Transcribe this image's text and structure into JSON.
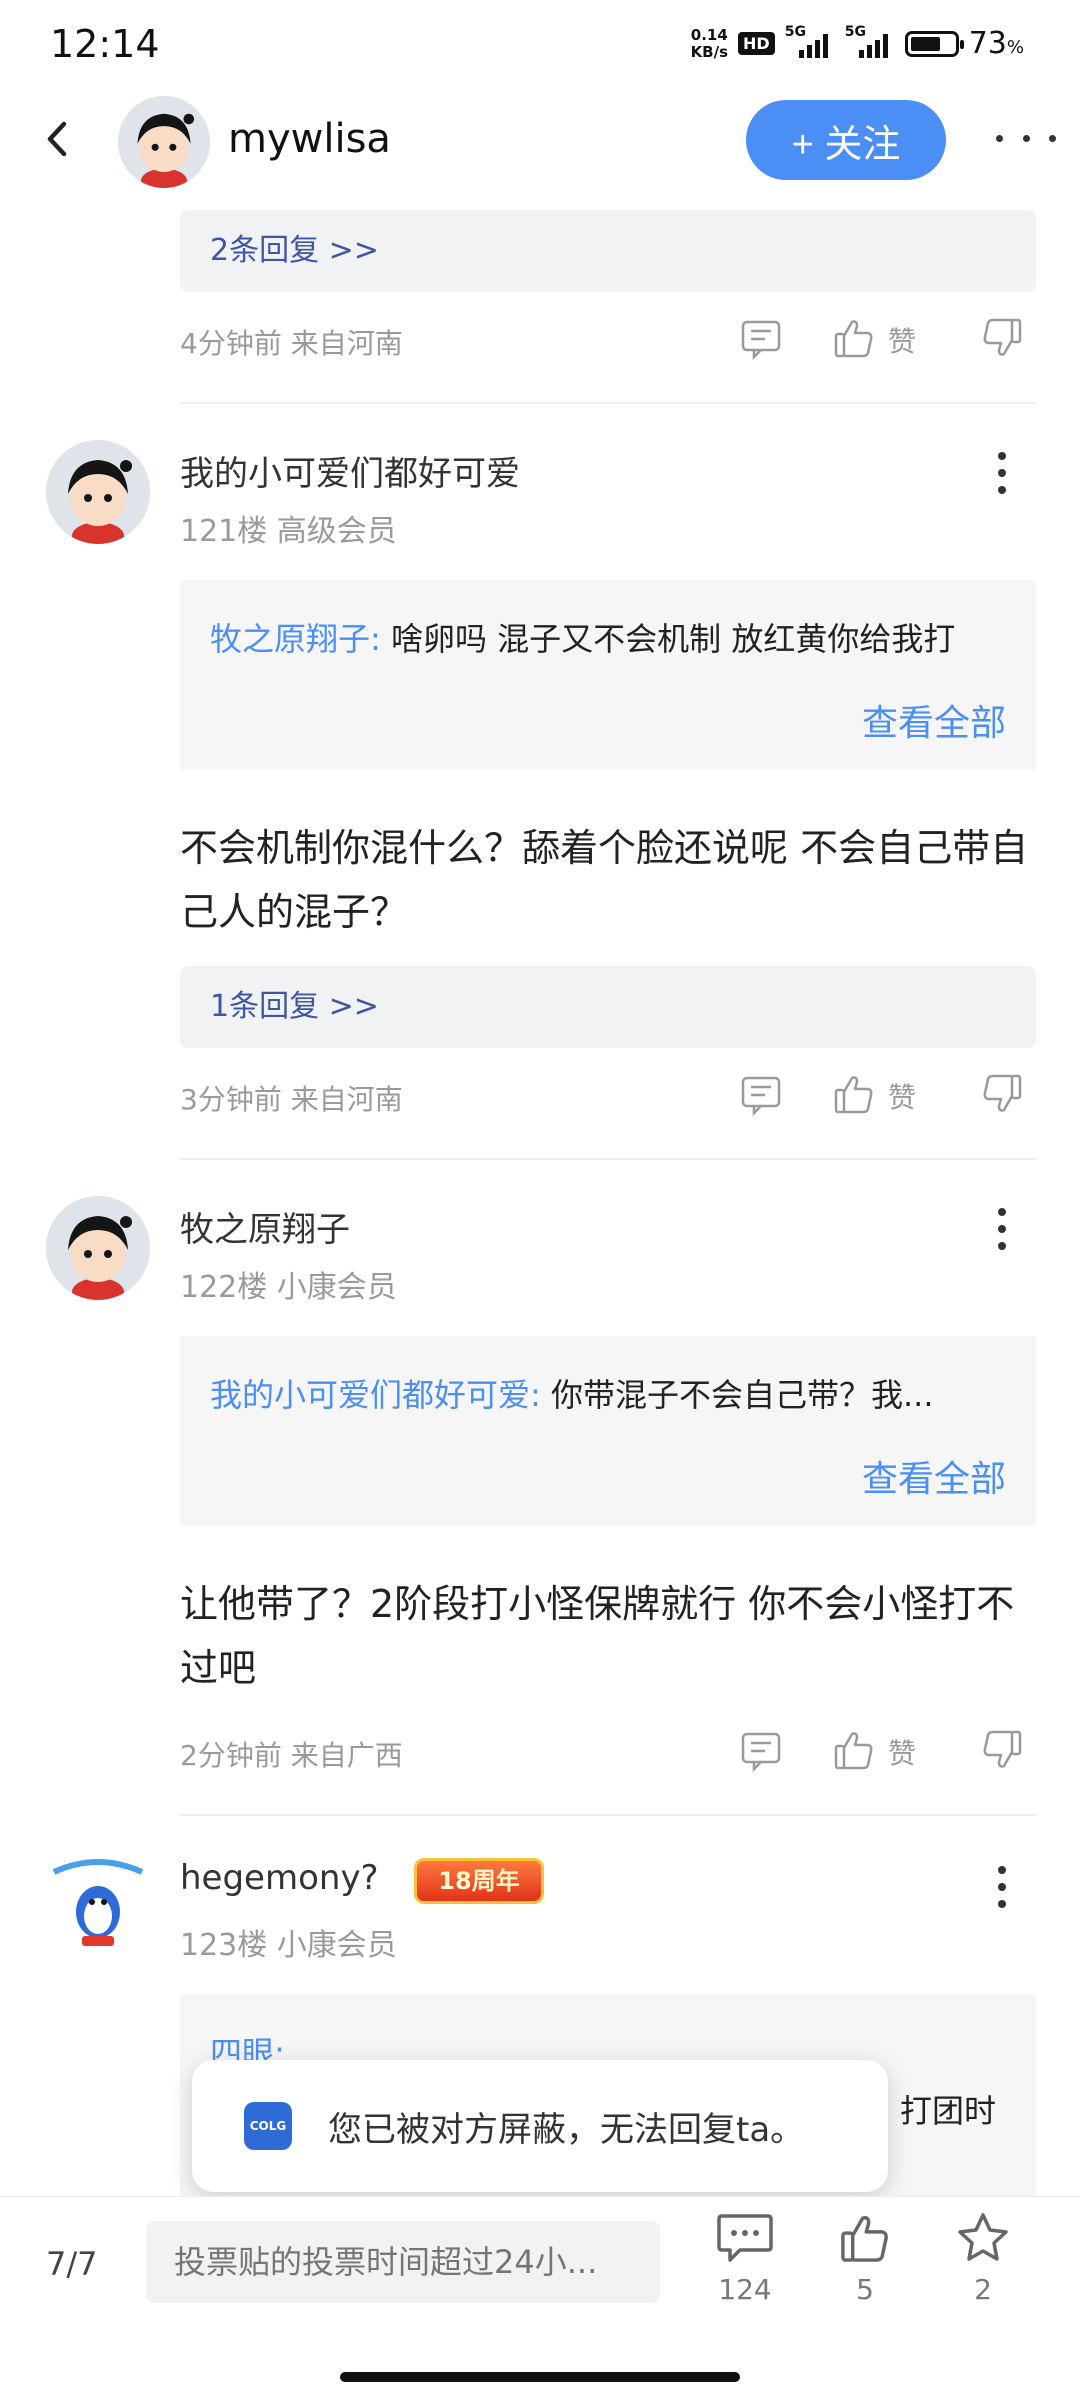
{
  "status_bar": {
    "time": "12:14",
    "net_speed_value": "0.14",
    "net_speed_unit": "KB/s",
    "hd": "HD",
    "sig1": "5G",
    "sig2": "5G",
    "battery": "73",
    "battery_unit": "%",
    "battery_level": 0.73
  },
  "header": {
    "username": "mywlisa",
    "follow_label": "+ 关注"
  },
  "top_section": {
    "reply_link": "2条回复 >>",
    "meta": "4分钟前 来自河南",
    "like_label": "赞"
  },
  "posts": [
    {
      "username": "我的小可爱们都好可爱",
      "floor": "121楼 高级会员",
      "quote_name": "牧之原翔子:",
      "quote_text": " 啥卵吗 混子又不会机制 放红黄你给我打",
      "see_all": "查看全部",
      "body": "不会机制你混什么？舔着个脸还说呢  不会自己带自己人的混子？",
      "reply_link": "1条回复 >>",
      "meta": "3分钟前 来自河南",
      "like_label": "赞"
    },
    {
      "username": "牧之原翔子",
      "floor": "122楼 小康会员",
      "quote_name": "我的小可爱们都好可爱:",
      "quote_text": " 你带混子不会自己带？我...",
      "see_all": "查看全部",
      "body": "让他带了？2阶段打小怪保牌就行 你不会小怪打不过吧",
      "meta": "2分钟前 来自广西",
      "like_label": "赞"
    },
    {
      "username": "hegemony?",
      "badge": "18周年",
      "floor": "123楼 小康会员",
      "quote_name": "四眼:",
      "quote_text": "打团时"
    }
  ],
  "toast": {
    "logo": "COLG",
    "text": "您已被对方屏蔽，无法回复ta。"
  },
  "bottom_bar": {
    "pager": "7/7",
    "input_placeholder": "投票贴的投票时间超过24小...",
    "comments": "124",
    "likes": "5",
    "favorites": "2"
  },
  "colors": {
    "accent": "#4b8ef5",
    "link": "#3e55a6",
    "muted": "#9a9a9a"
  }
}
